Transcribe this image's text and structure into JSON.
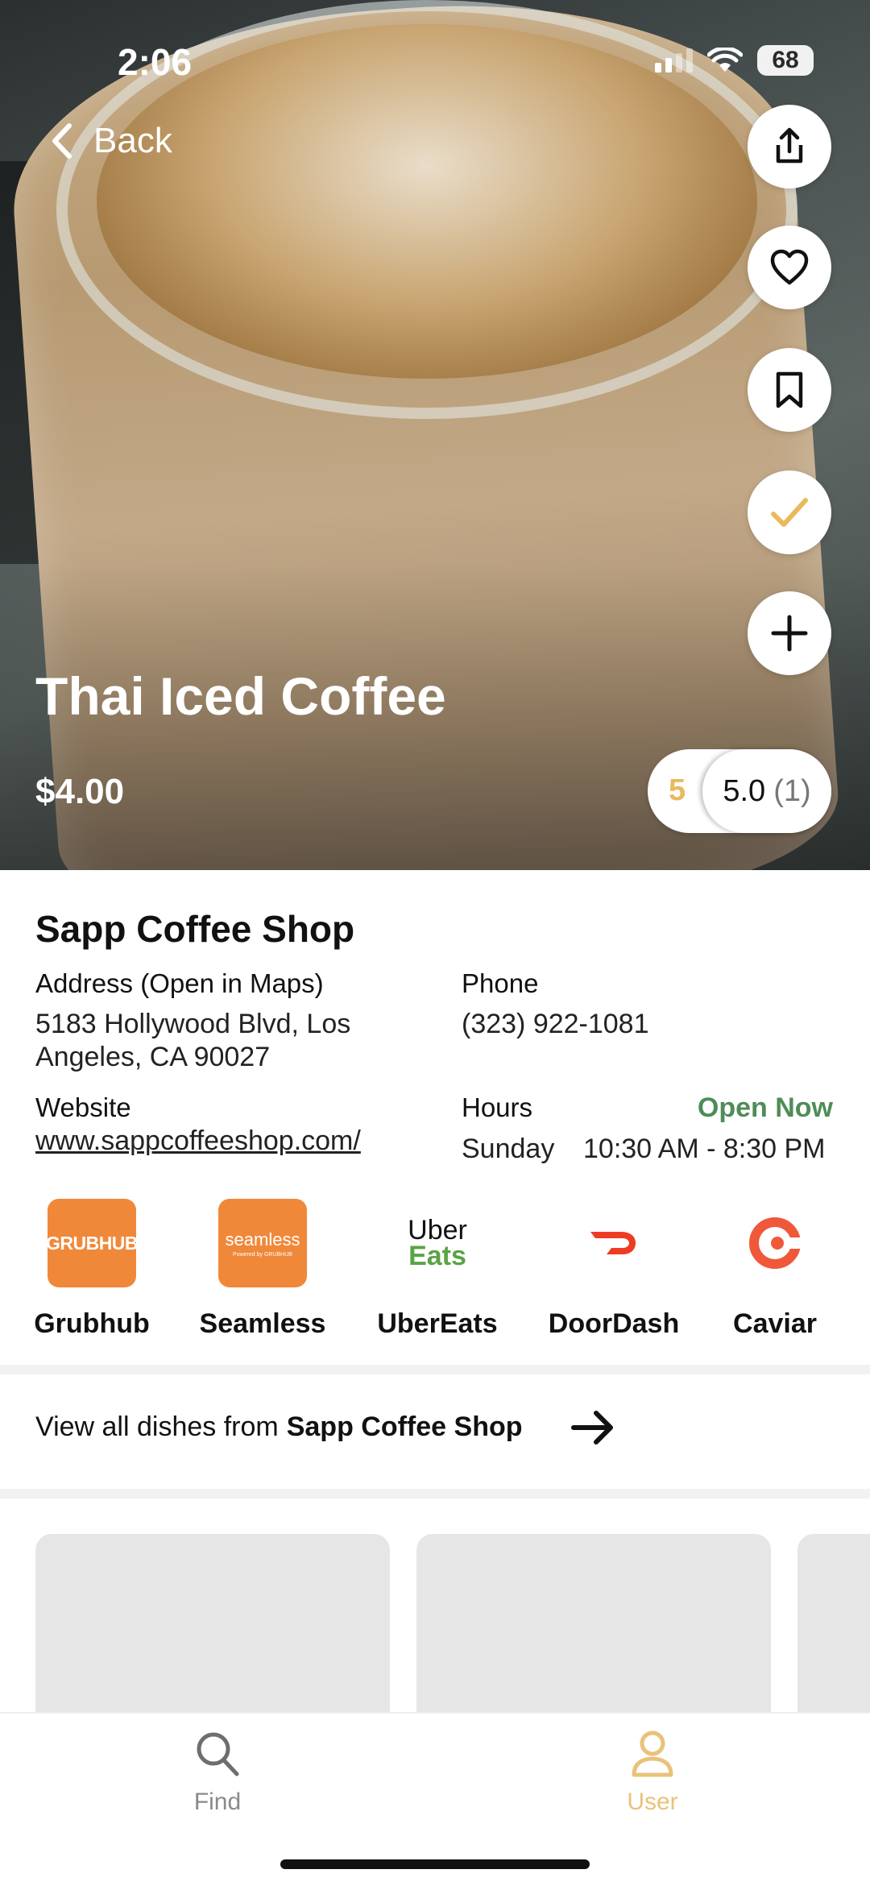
{
  "status_bar": {
    "time": "2:06",
    "battery": "68"
  },
  "nav": {
    "back_label": "Back"
  },
  "actions": [
    {
      "name": "share-button",
      "icon": "share-icon"
    },
    {
      "name": "favorite-button",
      "icon": "heart-icon"
    },
    {
      "name": "bookmark-button",
      "icon": "bookmark-icon"
    },
    {
      "name": "tried-button",
      "icon": "checkmark-icon",
      "color": "#e9b95b"
    },
    {
      "name": "add-button",
      "icon": "plus-icon"
    }
  ],
  "dish": {
    "title": "Thai Iced Coffee",
    "price": "$4.00",
    "your_rating": "5",
    "avg_rating": "5.0",
    "rating_count": "(1)"
  },
  "shop": {
    "name": "Sapp Coffee Shop",
    "address_label": "Address (Open in Maps)",
    "address_line1": "5183 Hollywood Blvd, Los",
    "address_line2": "Angeles, CA 90027",
    "phone_label": "Phone",
    "phone": "(323) 922-1081",
    "website_label": "Website",
    "website": "www.sappcoffeeshop.com/",
    "hours_label": "Hours",
    "open_status": "Open Now",
    "day": "Sunday",
    "hours": "10:30 AM - 8:30 PM"
  },
  "delivery_services": [
    {
      "name": "Grubhub",
      "logo_text": "GRUBHUB",
      "color": "#f0883a"
    },
    {
      "name": "Seamless",
      "logo_text": "seamless",
      "logo_sub": "Powered by GRUBHUB",
      "color": "#f0883a"
    },
    {
      "name": "UberEats",
      "logo_text": "Uber",
      "logo_text2": "Eats",
      "color": "#5aa346"
    },
    {
      "name": "DoorDash",
      "color": "#ef3b24"
    },
    {
      "name": "Caviar",
      "color": "#f0583a"
    }
  ],
  "view_all": {
    "prefix": "View all dishes from",
    "shop": "Sapp Coffee Shop"
  },
  "tabs": [
    {
      "label": "Find",
      "icon": "search-icon",
      "active": false
    },
    {
      "label": "User",
      "icon": "user-icon",
      "active": true,
      "color": "#e9c27a"
    }
  ]
}
